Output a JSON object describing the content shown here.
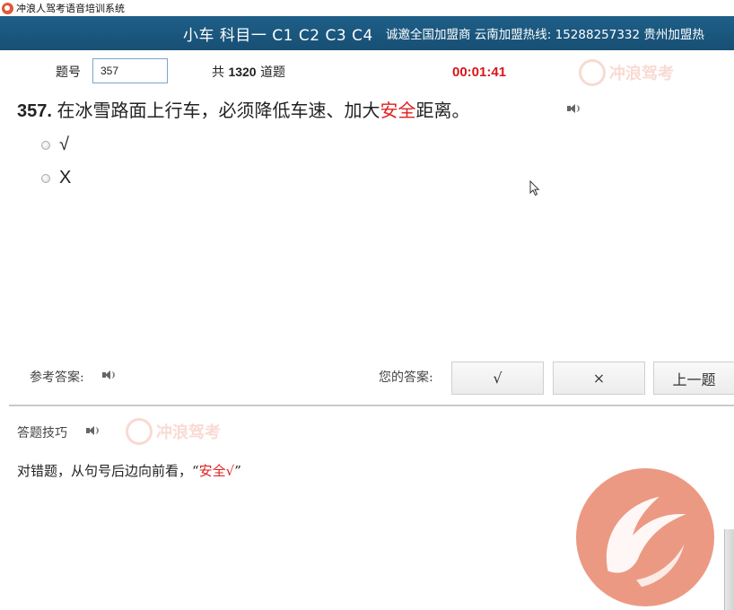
{
  "window": {
    "title": "冲浪人驾考语音培训系统"
  },
  "banner": {
    "main": "小车 科目一 C1 C2 C3 C4",
    "sub": "诚邀全国加盟商 云南加盟热线: 15288257332 贵州加盟热"
  },
  "header": {
    "qnum_label": "题号",
    "qnum_value": "357",
    "total_prefix": "共",
    "total_count": "1320",
    "total_suffix": "道题",
    "timer": "00:01:41"
  },
  "watermark": {
    "text": "冲浪驾考"
  },
  "question": {
    "number": "357.",
    "text_before": "在冰雪路面上行车，必须降低车速、加大",
    "text_highlight": "安全",
    "text_after": "距离。"
  },
  "options": [
    {
      "label": "√"
    },
    {
      "label": "X"
    }
  ],
  "answer_bar": {
    "reference_label": "参考答案:",
    "your_answer_label": "您的答案:",
    "true_button": "√",
    "false_button": "×",
    "prev_button": "上一题"
  },
  "tips": {
    "title": "答题技巧",
    "text_before": "对错题，从句号后边向前看，“",
    "text_highlight": "安全√",
    "text_after": "”"
  },
  "colors": {
    "banner": "#1e5f88",
    "timer": "#d8161b",
    "highlight": "#e01f1f",
    "logo": "#e25a3a"
  }
}
